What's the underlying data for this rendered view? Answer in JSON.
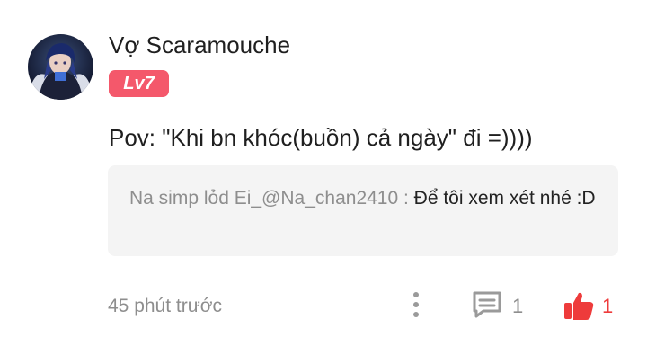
{
  "comment": {
    "username": "Vợ Scaramouche",
    "level_badge": "Lv7",
    "text": "Pov: \"Khi bn khóc(buồn) cả ngày\" đi =))))",
    "reply": {
      "author": "Na simp lỏd Ei_@Na_chan2410 : ",
      "text": "Để tôi xem xét nhé :D"
    },
    "timestamp": "45 phút trước",
    "reply_count": "1",
    "like_count": "1"
  },
  "icons": {
    "more": "more-vertical-icon",
    "reply": "comment-icon",
    "like": "thumbs-up-icon"
  },
  "colors": {
    "badge": "#f4586b",
    "like": "#ee3b3b",
    "muted": "#8e8e8e",
    "reply_bg": "#f4f4f4"
  }
}
